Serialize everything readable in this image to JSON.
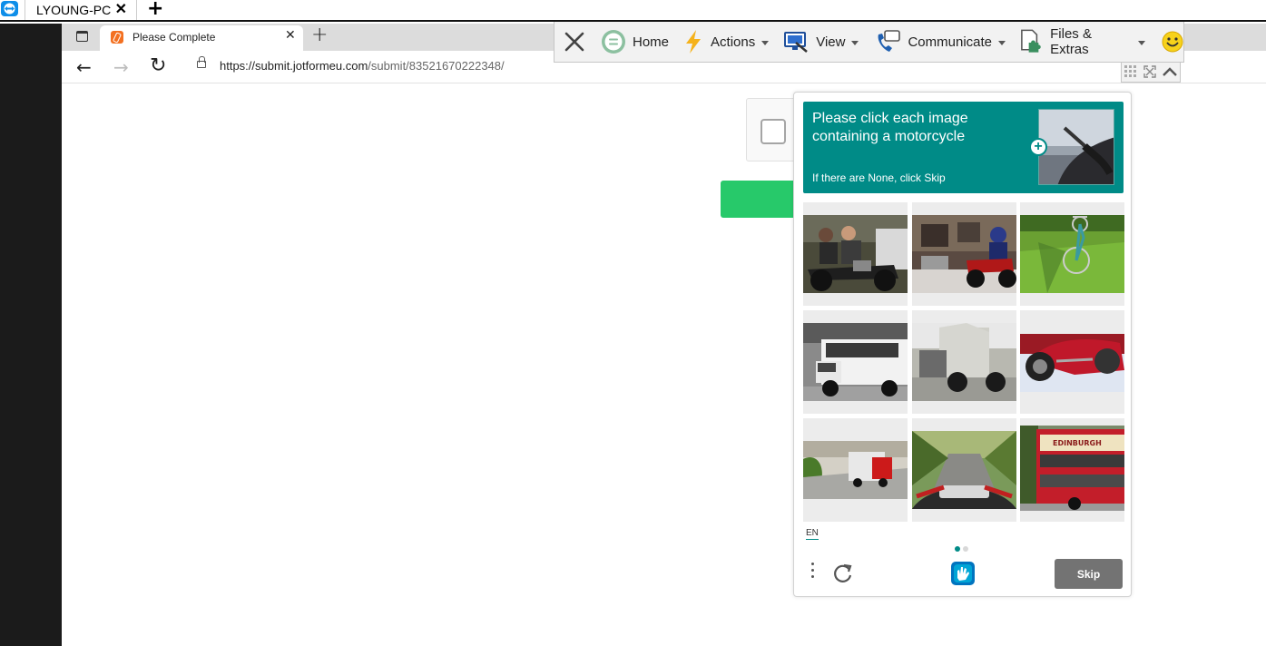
{
  "teamviewer": {
    "session_tab": "LYOUNG-PC",
    "close_glyph": "✕",
    "add_glyph": "+",
    "toolbar": {
      "home": "Home",
      "actions": "Actions",
      "view": "View",
      "communicate": "Communicate",
      "files_extras": "Files & Extras"
    },
    "colors": {
      "accent": "#0e8ee9",
      "lightning": "#f5b21b"
    }
  },
  "browser": {
    "tab_title": "Please Complete",
    "tab_close": "✕",
    "new_tab": "+",
    "back": "←",
    "forward": "→",
    "reload": "↻",
    "url_host": "https://submit.jotformeu.com",
    "url_path": "/submit/83521670222348/"
  },
  "page": {
    "submit_color": "#27c96a"
  },
  "captcha": {
    "prompt": "Please click each image containing a motorcycle",
    "sub_prompt": "If there are None, click Skip",
    "language": "EN",
    "skip_label": "Skip",
    "accent": "#008b87",
    "page_dots": 2,
    "active_page": 1,
    "tiles": [
      "two-riders-on-motorcycle",
      "motorcycle-in-garage",
      "bicycle-on-grass",
      "white-shuttle-bus",
      "truck-on-street",
      "red-sport-motorcycle",
      "red-truck-on-road",
      "motorcycle-handlebar-view",
      "red-double-decker-bus"
    ]
  }
}
